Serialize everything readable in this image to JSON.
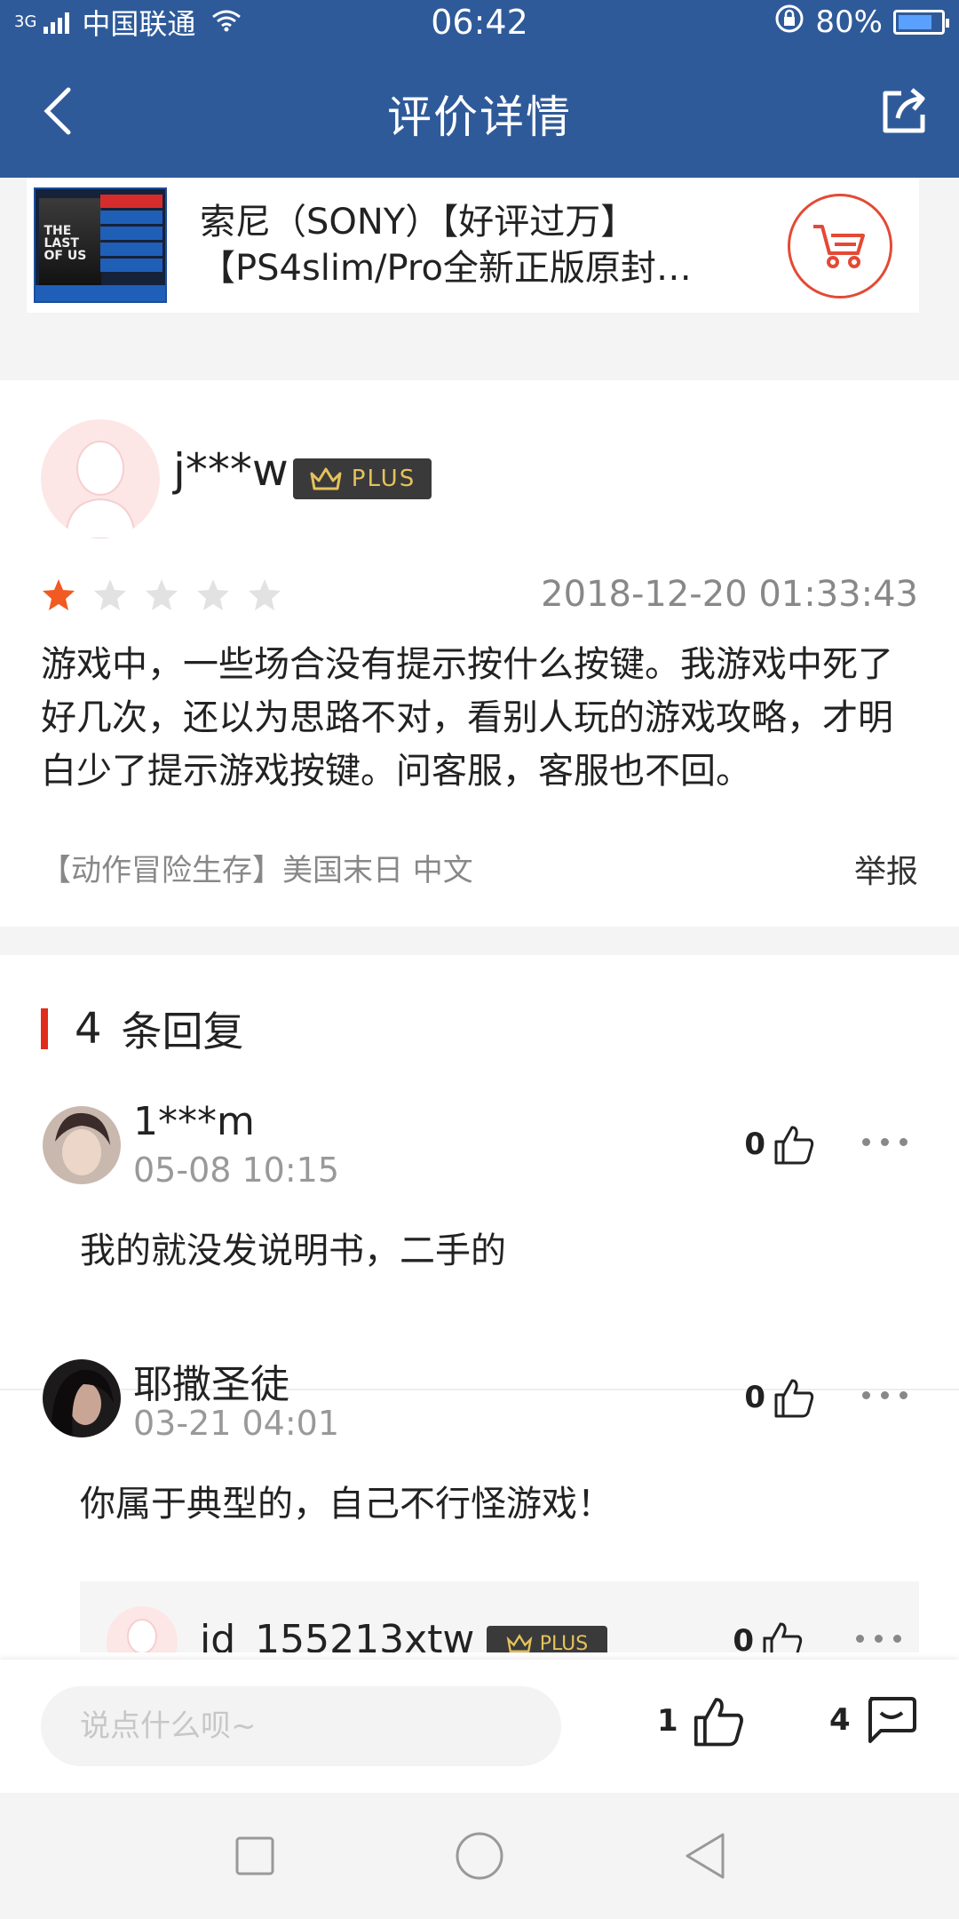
{
  "status": {
    "network": "3G",
    "carrier": "中国联通",
    "time": "06:42",
    "battery": "80%"
  },
  "nav": {
    "title": "评价详情"
  },
  "product": {
    "title_line1": "索尼（SONY）【好评过万】",
    "title_line2": "【PS4slim/Pro全新正版原封…"
  },
  "review": {
    "username": "j***w",
    "badge": "PLUS",
    "rating": 1,
    "rating_max": 5,
    "date": "2018-12-20 01:33:43",
    "content": "游戏中，一些场合没有提示按什么按键。我游戏中死了好几次，还以为思路不对，看别人玩的游戏攻略，才明白少了提示游戏按键。问客服，客服也不回。",
    "tag": "【动作冒险生存】美国末日 中文",
    "report": "举报"
  },
  "replies": {
    "count": "4",
    "label": "条回复",
    "items": [
      {
        "name": "1***m",
        "time": "05-08 10:15",
        "likes": "0",
        "text": "我的就没发说明书，二手的"
      },
      {
        "name": "耶撒圣徒",
        "time": "03-21 04:01",
        "likes": "0",
        "text": "你属于典型的，自己不行怪游戏！"
      }
    ],
    "sub": {
      "name": "id_155213xtw",
      "badge": "PLUS",
      "likes": "0"
    }
  },
  "compose": {
    "placeholder": "说点什么呗~",
    "likes": "1",
    "comments": "4"
  },
  "colors": {
    "primary": "#2f5a9a",
    "accent": "#e02c1c",
    "star_active": "#f15a22"
  }
}
